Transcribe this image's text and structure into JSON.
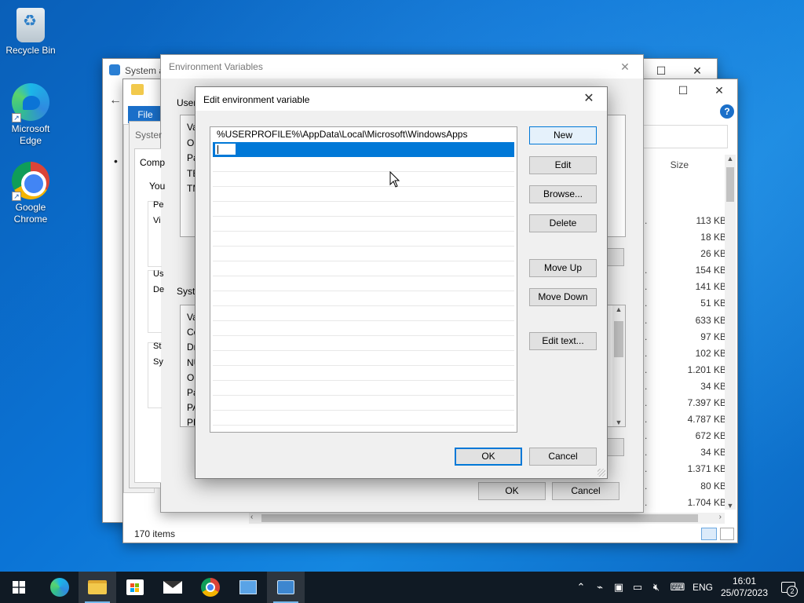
{
  "desktop": {
    "icons": [
      {
        "label": "Recycle Bin"
      },
      {
        "label": "Microsoft Edge"
      },
      {
        "label": "Google Chrome"
      }
    ]
  },
  "system_window": {
    "title": "System a"
  },
  "explorer": {
    "ribbon_file": "File",
    "column_size": "Size",
    "status": "170 items",
    "sizes": [
      "113 KB",
      "18 KB",
      "26 KB",
      "154 KB",
      "141 KB",
      "51 KB",
      "633 KB",
      "97 KB",
      "102 KB",
      "1.201 KB",
      "34 KB",
      "7.397 KB",
      "4.787 KB",
      "672 KB",
      "34 KB",
      "1.371 KB",
      "80 KB",
      "1.704 KB"
    ],
    "name_fragment": "en..."
  },
  "env_vars": {
    "title": "Environment Variables",
    "user_group": "User",
    "user_col": "Va",
    "user_rows": [
      "On",
      "Pa",
      "TE",
      "TM"
    ],
    "system_group": "Syste",
    "system_col": "Va",
    "system_rows": [
      "Co",
      "Dr",
      "NU",
      "OS",
      "Pa",
      "PA",
      "PR"
    ],
    "ok": "OK",
    "cancel": "Cancel"
  },
  "sysprops_frag": {
    "tab": "Comp",
    "line1": "You",
    "g1": "Pe",
    "g1b": "Vi",
    "g2": "Us",
    "g2b": "De",
    "g3": "St",
    "g3b": "Sy",
    "title_frag": "Syster"
  },
  "edit_dialog": {
    "title": "Edit environment variable",
    "entries": [
      "%USERPROFILE%\\AppData\\Local\\Microsoft\\WindowsApps"
    ],
    "buttons": {
      "new": "New",
      "edit": "Edit",
      "browse": "Browse...",
      "delete": "Delete",
      "move_up": "Move Up",
      "move_down": "Move Down",
      "edit_text": "Edit text...",
      "ok": "OK",
      "cancel": "Cancel"
    }
  },
  "taskbar": {
    "language": "ENG",
    "time": "16:01",
    "date": "25/07/2023",
    "notifications": "2"
  },
  "colors": {
    "accent": "#0078d7",
    "taskbar": "#101a24",
    "desktop": "#0b74d6"
  }
}
